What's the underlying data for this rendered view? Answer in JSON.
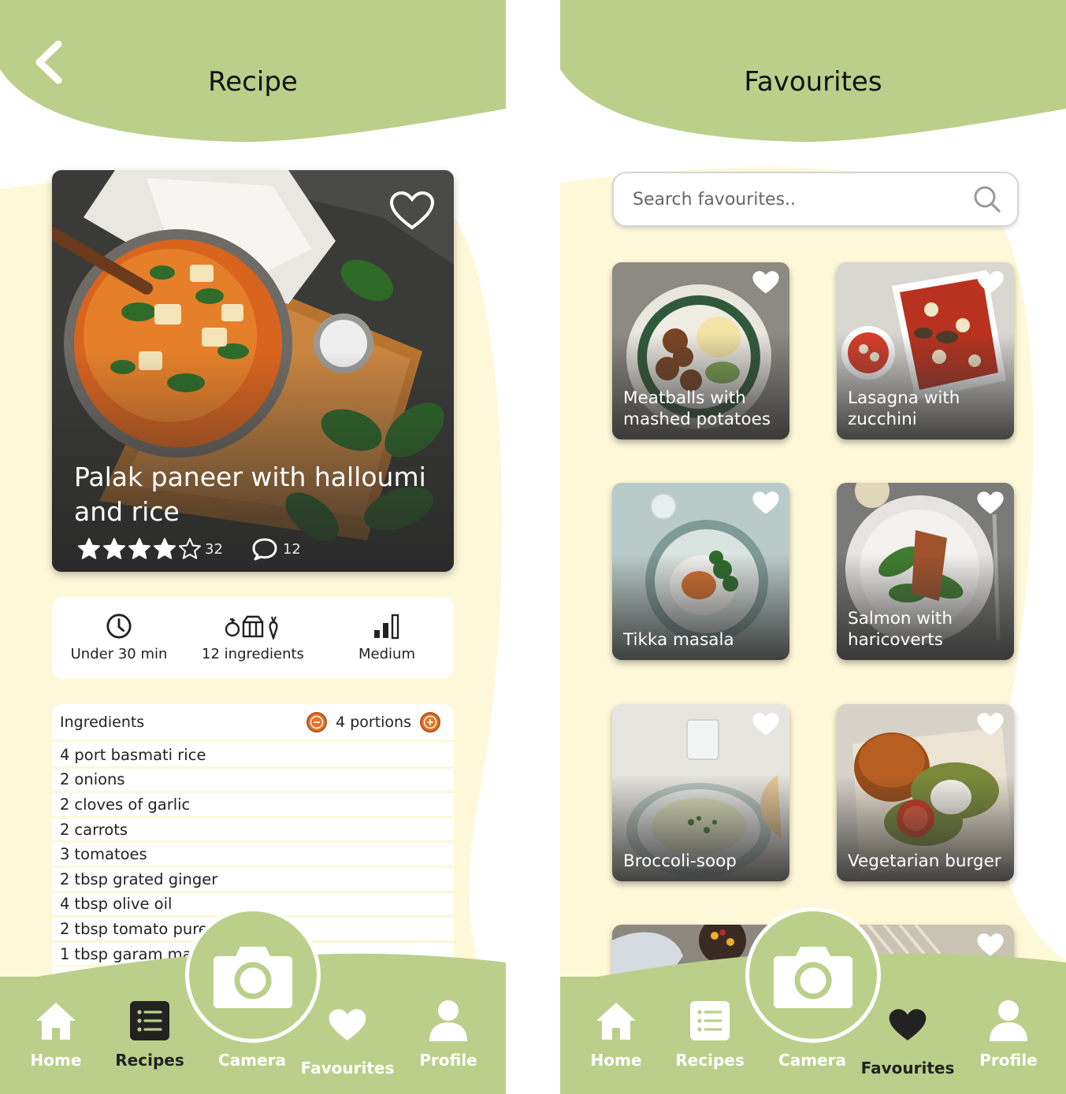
{
  "colors": {
    "accent_green": "#bccf8a",
    "cream": "#fdf8d8",
    "orange": "#e2742a",
    "dark": "#222222",
    "white": "#ffffff"
  },
  "recipe_screen": {
    "title": "Recipe",
    "hero": {
      "title": "Palak paneer with halloumi and rice",
      "rating": {
        "stars": 4,
        "max": 5,
        "count": "32"
      },
      "comments": "12"
    },
    "info": [
      {
        "icon": "clock-icon",
        "label": "Under 30 min"
      },
      {
        "icon": "ingredients-icon",
        "label": "12 ingredients"
      },
      {
        "icon": "difficulty-bars-icon",
        "label": "Medium"
      }
    ],
    "ingredients": {
      "header": "Ingredients",
      "portions": "4 portions",
      "items": [
        {
          "qty": "4",
          "name": "port basmati rice"
        },
        {
          "qty": "2",
          "name": "onions"
        },
        {
          "qty": "2",
          "name": "cloves of garlic"
        },
        {
          "qty": "2",
          "name": "carrots"
        },
        {
          "qty": "3",
          "name": "tomatoes"
        },
        {
          "qty": "2",
          "name": "tbsp grated ginger"
        },
        {
          "qty": "4",
          "name": "tbsp olive oil"
        },
        {
          "qty": "2",
          "name": "tbsp tomato pure"
        },
        {
          "qty": "1",
          "name": "tbsp garam masala"
        }
      ]
    }
  },
  "favourites_screen": {
    "title": "Favourites",
    "search": {
      "placeholder": "Search favourites.."
    },
    "tiles": [
      {
        "label": "Meatballs with mashed potatoes"
      },
      {
        "label": "Lasagna with zucchini"
      },
      {
        "label": "Tikka masala"
      },
      {
        "label": "Salmon with haricoverts"
      },
      {
        "label": "Broccoli-soop"
      },
      {
        "label": "Vegetarian burger"
      }
    ]
  },
  "nav": {
    "home": "Home",
    "recipes": "Recipes",
    "camera": "Camera",
    "favourites": "Favourites",
    "profile": "Profile"
  }
}
